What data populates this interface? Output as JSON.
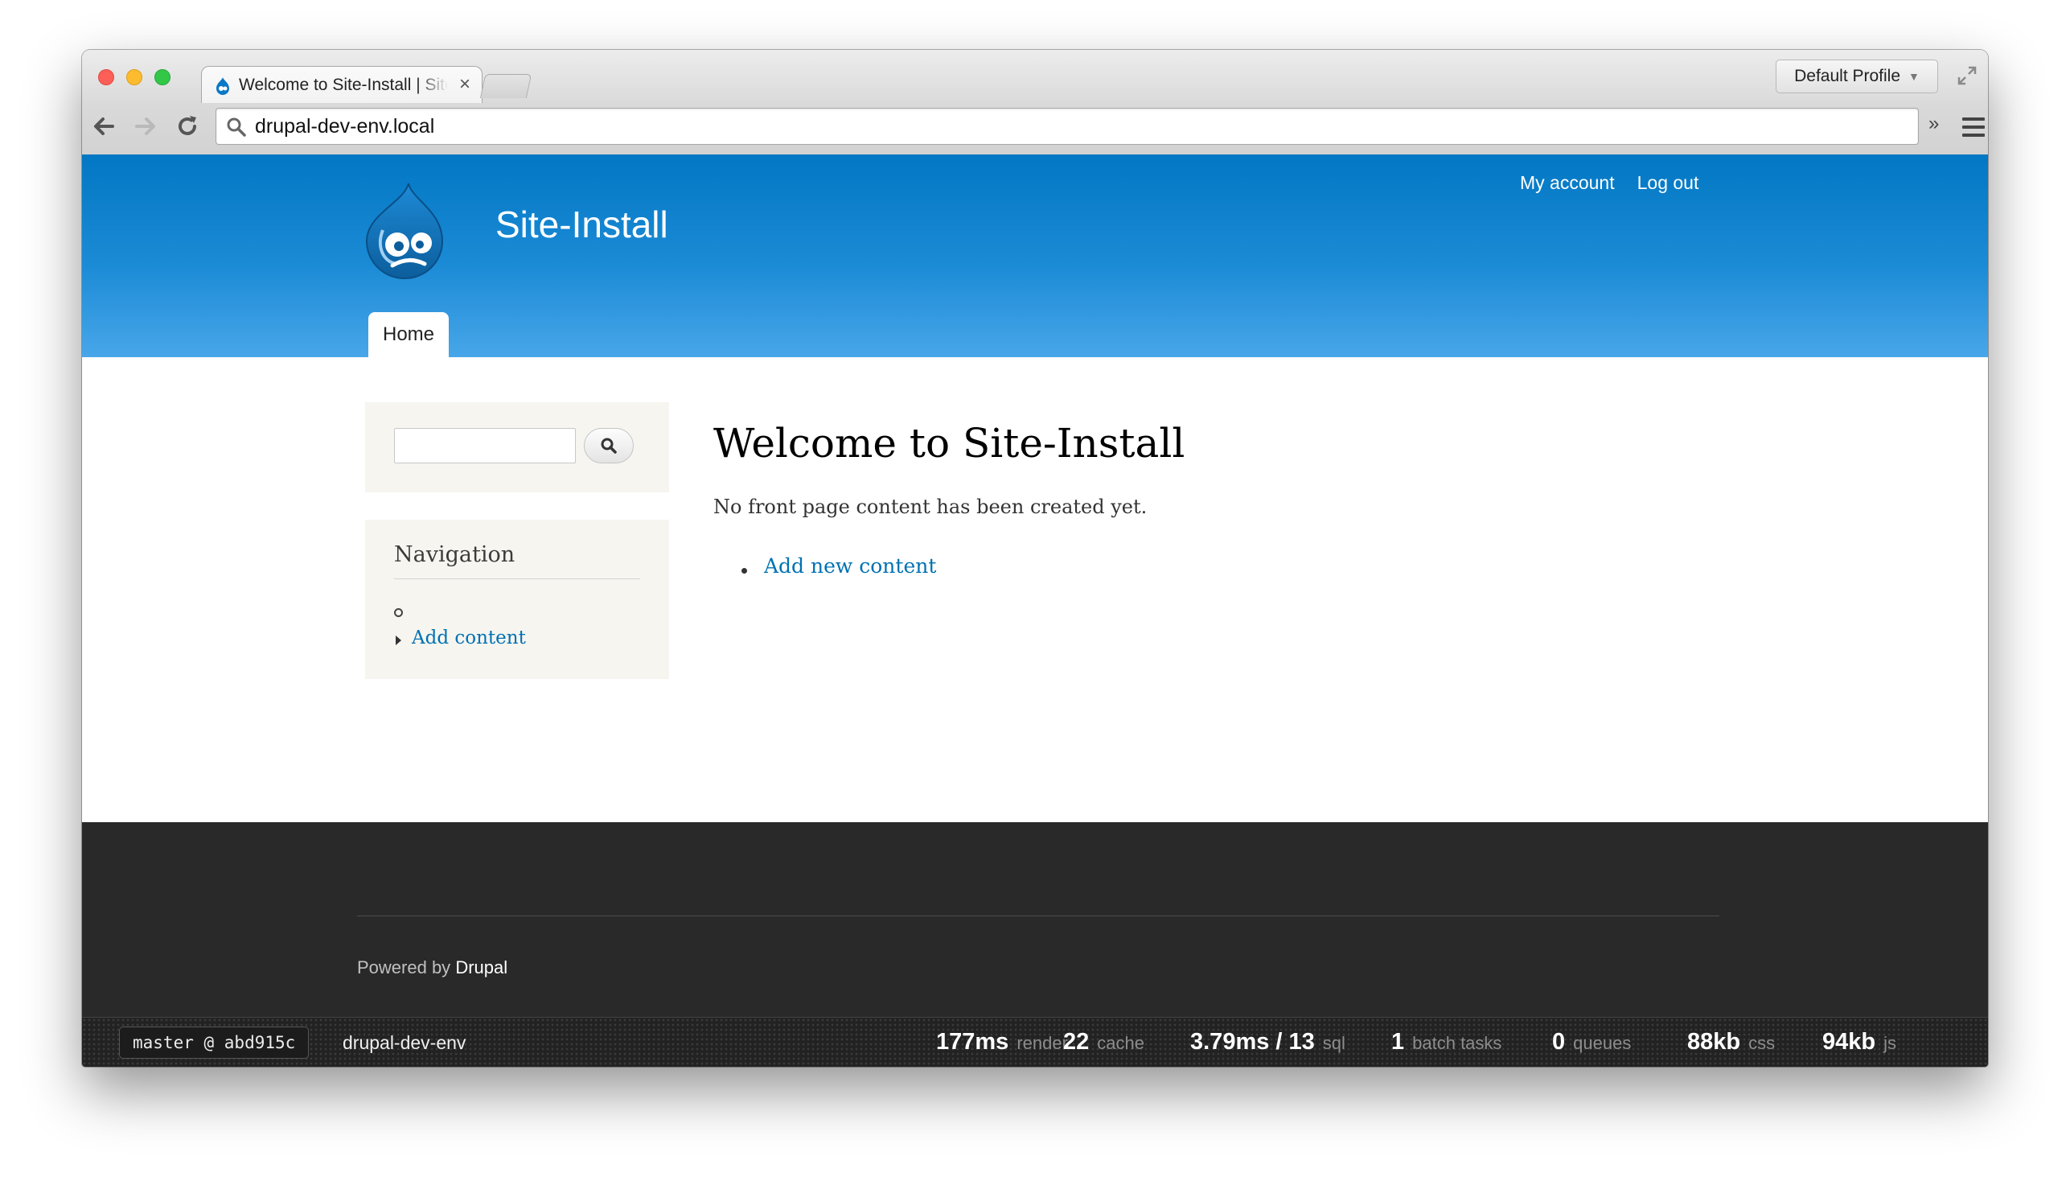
{
  "browser": {
    "tab_title": "Welcome to Site-Install | Site-Install",
    "profile_label": "Default Profile",
    "address": "drupal-dev-env.local",
    "extensions_glyph": "»"
  },
  "site": {
    "name": "Site-Install",
    "secondary_menu": [
      "My account",
      "Log out"
    ],
    "main_menu": [
      "Home"
    ]
  },
  "sidebar": {
    "navigation_title": "Navigation",
    "navigation_items": [
      "Add content"
    ]
  },
  "main": {
    "title": "Welcome to Site-Install",
    "message": "No front page content has been created yet.",
    "links": [
      "Add new content"
    ]
  },
  "footer": {
    "powered_prefix": "Powered by",
    "powered_link": "Drupal"
  },
  "devbar": {
    "branch": "master @ abd915c",
    "environment": "drupal-dev-env",
    "stats": [
      {
        "value": "177ms",
        "label": "render"
      },
      {
        "value": "22",
        "label": "cache"
      },
      {
        "value": "3.79ms / 13",
        "label": "sql"
      },
      {
        "value": "1",
        "label": "batch tasks"
      },
      {
        "value": "0",
        "label": "queues"
      },
      {
        "value": "88kb",
        "label": "css"
      },
      {
        "value": "94kb",
        "label": "js"
      }
    ]
  },
  "colors": {
    "header_top": "#0277c3",
    "header_bottom": "#48a6e9",
    "link": "#0071b3",
    "footer_bg": "#292929"
  }
}
